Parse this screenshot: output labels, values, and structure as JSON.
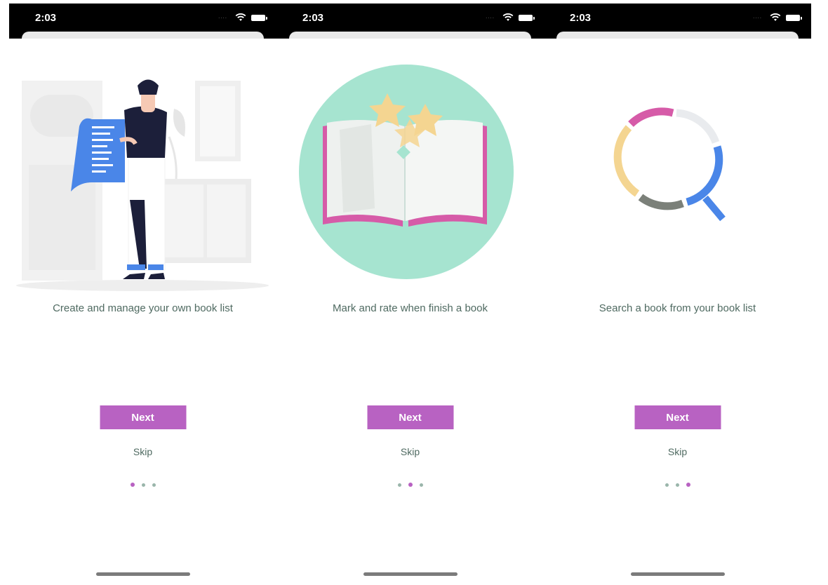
{
  "colors": {
    "accent": "#b862c2",
    "text": "#4f6a61",
    "dot_inactive": "#9ab6ab",
    "teal": "#a6e4d0",
    "blue": "#4a86e8",
    "yellow": "#f4d591",
    "gray": "#7b8079"
  },
  "screens": [
    {
      "status": {
        "time": "2:03",
        "icons": [
          "wifi-icon",
          "battery-icon"
        ]
      },
      "illustration": "person-reading-list-illustration",
      "caption": "Create and manage your own book list",
      "next_label": "Next",
      "skip_label": "Skip",
      "active_page": 1,
      "page_count": 3
    },
    {
      "status": {
        "time": "2:03",
        "icons": [
          "wifi-icon",
          "battery-icon"
        ]
      },
      "illustration": "open-book-stars-illustration",
      "caption": "Mark and rate when finish a book",
      "next_label": "Next",
      "skip_label": "Skip",
      "active_page": 2,
      "page_count": 3
    },
    {
      "status": {
        "time": "2:03",
        "icons": [
          "wifi-icon",
          "battery-icon"
        ]
      },
      "illustration": "search-magnifier-illustration",
      "caption": "Search a book from your book list",
      "next_label": "Next",
      "skip_label": "Skip",
      "active_page": 3,
      "page_count": 3
    }
  ]
}
